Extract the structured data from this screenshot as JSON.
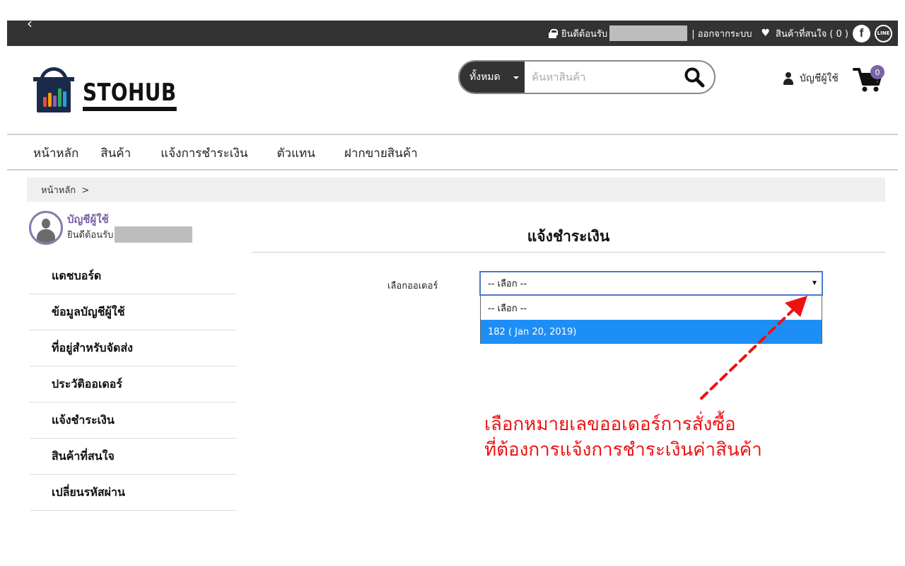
{
  "topbar": {
    "back_icon": "‹",
    "welcome": "ยินดีต้อนรับ",
    "logout": "| ออกจากระบบ",
    "wishlist": "สินค้าที่สนใจ ( 0 )",
    "facebook_glyph": "f",
    "line_glyph": "LINE"
  },
  "header": {
    "brand": "STOHUB",
    "search_category": "ทั้งหมด",
    "search_placeholder": "ค้นหาสินค้า",
    "account_label": "บัญชีผู้ใช้",
    "cart_count": "0"
  },
  "nav": {
    "items": [
      "หน้าหลัก",
      "สินค้า",
      "แจ้งการชำระเงิน",
      "ตัวแทน",
      "ฝากขายสินค้า"
    ]
  },
  "breadcrumb": {
    "text": "หน้าหลัก  >"
  },
  "sidebar": {
    "profile_title": "บัญชีผู้ใช้",
    "profile_welcome": "ยินดีต้อนรับ",
    "items": [
      "แดชบอร์ด",
      "ข้อมูลบัญชีผู้ใช้",
      "ที่อยู่สำหรับจัดส่ง",
      "ประวัติออเดอร์",
      "แจ้งชำระเงิน",
      "สินค้าที่สนใจ",
      "เปลี่ยนรหัสผ่าน"
    ]
  },
  "content": {
    "title": "แจ้งชำระเงิน",
    "order_label": "เลือกออเดอร์",
    "select_value": "-- เลือก --",
    "options": [
      "-- เลือก --",
      "182 ( Jan 20, 2019)"
    ],
    "selected_index": 1
  },
  "annotation": {
    "line1": "เลือกหมายเลขออเดอร์การสั่งซื้อ",
    "line2": "ที่ต้องการแจ้งการชำระเงินค่าสินค้า",
    "color": "#ee1111"
  },
  "colors": {
    "topbar": "#333333",
    "accent": "#7b63a9",
    "highlight": "#1e8ef7"
  }
}
